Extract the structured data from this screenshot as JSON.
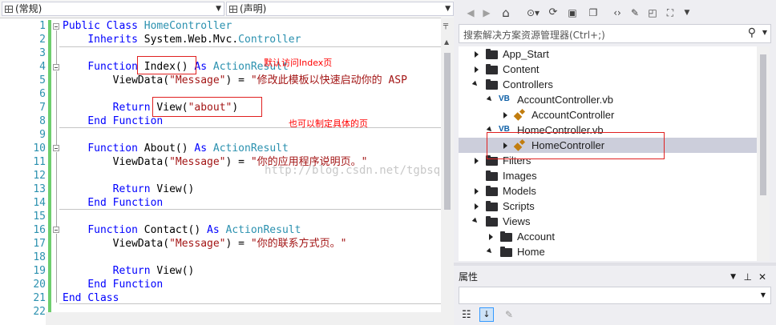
{
  "editor": {
    "nav_left": "(常规)",
    "nav_right": "(声明)",
    "lines": [
      {
        "n": "1",
        "code": "Public Class HomeController"
      },
      {
        "n": "2",
        "code": "    Inherits System.Web.Mvc.Controller"
      },
      {
        "n": "3",
        "code": ""
      },
      {
        "n": "4",
        "code": "    Function Index() As ActionResult"
      },
      {
        "n": "5",
        "code": "        ViewData(\"Message\") = \"修改此模板以快速启动你的 ASP"
      },
      {
        "n": "6",
        "code": ""
      },
      {
        "n": "7",
        "code": "        Return View(\"about\")"
      },
      {
        "n": "8",
        "code": "    End Function"
      },
      {
        "n": "9",
        "code": ""
      },
      {
        "n": "10",
        "code": "    Function About() As ActionResult"
      },
      {
        "n": "11",
        "code": "        ViewData(\"Message\") = \"你的应用程序说明页。\""
      },
      {
        "n": "12",
        "code": ""
      },
      {
        "n": "13",
        "code": "        Return View()"
      },
      {
        "n": "14",
        "code": "    End Function"
      },
      {
        "n": "15",
        "code": ""
      },
      {
        "n": "16",
        "code": "    Function Contact() As ActionResult"
      },
      {
        "n": "17",
        "code": "        ViewData(\"Message\") = \"你的联系方式页。\""
      },
      {
        "n": "18",
        "code": ""
      },
      {
        "n": "19",
        "code": "        Return View()"
      },
      {
        "n": "20",
        "code": "    End Function"
      },
      {
        "n": "21",
        "code": "End Class"
      },
      {
        "n": "22",
        "code": ""
      }
    ],
    "annotation_default": "默认访问Index页",
    "annotation_specific": "也可以制定具体的页",
    "watermark": "http://blog.csdn.net/tgbsql..."
  },
  "solution_explorer": {
    "search_placeholder": "搜索解决方案资源管理器(Ctrl+;)",
    "items": [
      {
        "label": "App_Start",
        "icon": "folder-icon",
        "state": "collapsed",
        "depth": 0
      },
      {
        "label": "Content",
        "icon": "folder-icon",
        "state": "collapsed",
        "depth": 0
      },
      {
        "label": "Controllers",
        "icon": "folder-icon",
        "state": "expanded",
        "depth": 0
      },
      {
        "label": "AccountController.vb",
        "icon": "vb-file-icon",
        "state": "expanded",
        "depth": 1
      },
      {
        "label": "AccountController",
        "icon": "class-icon",
        "state": "collapsed",
        "depth": 2
      },
      {
        "label": "HomeController.vb",
        "icon": "vb-file-icon",
        "state": "expanded",
        "depth": 1
      },
      {
        "label": "HomeController",
        "icon": "class-icon",
        "state": "collapsed",
        "depth": 2,
        "selected": true
      },
      {
        "label": "Filters",
        "icon": "folder-icon",
        "state": "collapsed",
        "depth": 0
      },
      {
        "label": "Images",
        "icon": "folder-icon",
        "state": "none",
        "depth": 0
      },
      {
        "label": "Models",
        "icon": "folder-icon",
        "state": "collapsed",
        "depth": 0
      },
      {
        "label": "Scripts",
        "icon": "folder-icon",
        "state": "collapsed",
        "depth": 0
      },
      {
        "label": "Views",
        "icon": "folder-icon",
        "state": "expanded",
        "depth": 0
      },
      {
        "label": "Account",
        "icon": "folder-icon",
        "state": "collapsed",
        "depth": 1
      },
      {
        "label": "Home",
        "icon": "folder-icon",
        "state": "expanded",
        "depth": 1
      }
    ],
    "toolbar_icons": [
      "back-icon",
      "forward-icon",
      "home-icon",
      "history-icon",
      "sync-icon",
      "collapse-all-icon",
      "show-all-files-icon",
      "view-code-icon",
      "properties-wrench-icon",
      "preview-icon",
      "solution-view-icon"
    ]
  },
  "properties": {
    "title": "属性",
    "toolbar_icons": [
      "categorized-icon",
      "alphabetical-icon",
      "property-pages-icon"
    ]
  },
  "colors": {
    "keyword": "#0000ff",
    "type": "#2b91af",
    "string": "#a31515",
    "annotation": "#ff0000",
    "selection": "#cccedb",
    "panel_bg": "#eeeef2"
  }
}
